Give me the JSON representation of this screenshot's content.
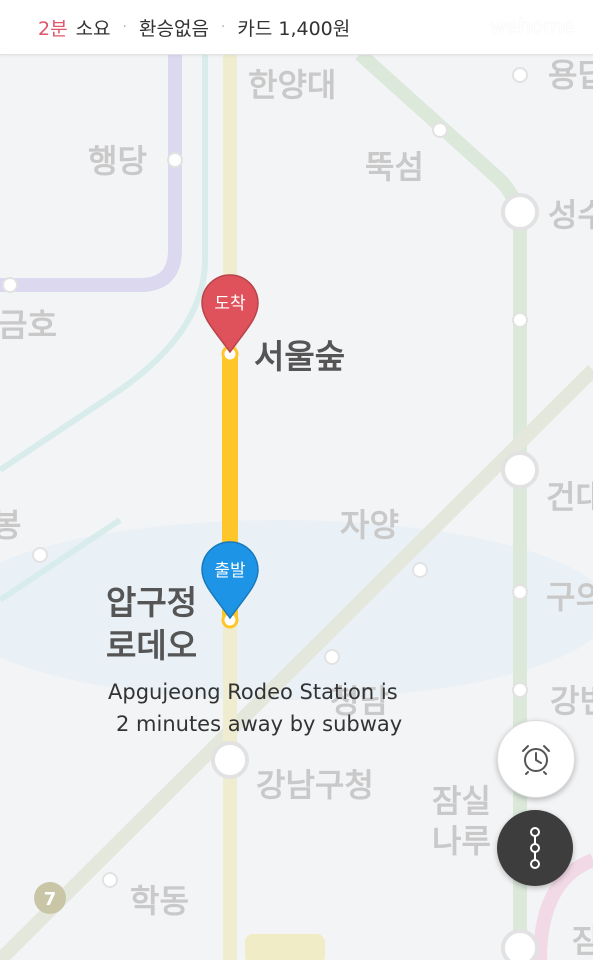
{
  "summary": {
    "duration": "2분",
    "duration_suffix": "소요",
    "transfer": "환승없음",
    "fare": "카드 1,400원",
    "separator": "·",
    "watermark": "wehome"
  },
  "stations": {
    "hanyangdae": "한양대",
    "haengdang": "행당",
    "ttukseom": "뚝섬",
    "yongdap_partial": "용답",
    "seongsu_partial": "성수",
    "geumho_partial": "금호",
    "geondae_partial": "건대",
    "oksu_partial": "봉",
    "jayang": "자양",
    "guui_partial": "구의",
    "cheongdam_partial": "청담",
    "gangbyeon_partial": "강변",
    "gangnamgucheong": "강남구청",
    "jamsil_naru": "잠실\n나루",
    "hakdong": "학동",
    "line7_badge": "7",
    "bottom_partial": "잠"
  },
  "route": {
    "arrival_pin_label": "도착",
    "departure_pin_label": "출발",
    "arrival_station": "서울숲",
    "departure_station_line1": "압구정",
    "departure_station_line2": "로데오",
    "caption_line1": "Apgujeong Rodeo Station is",
    "caption_line2": "2 minutes away by subway"
  },
  "buttons": {
    "alarm_icon": "alarm-clock-icon",
    "route_icon": "route-stops-icon"
  },
  "colors": {
    "route_line": "#ffc629",
    "arrival_pin": "#e0525b",
    "departure_pin": "#1e94e6",
    "duration_text": "#e0556a",
    "line_purple": "#d9d4ef",
    "line_green": "#d9e8d9",
    "line_yellow_faded": "#efeacb",
    "line_teal": "#d5ecea"
  }
}
